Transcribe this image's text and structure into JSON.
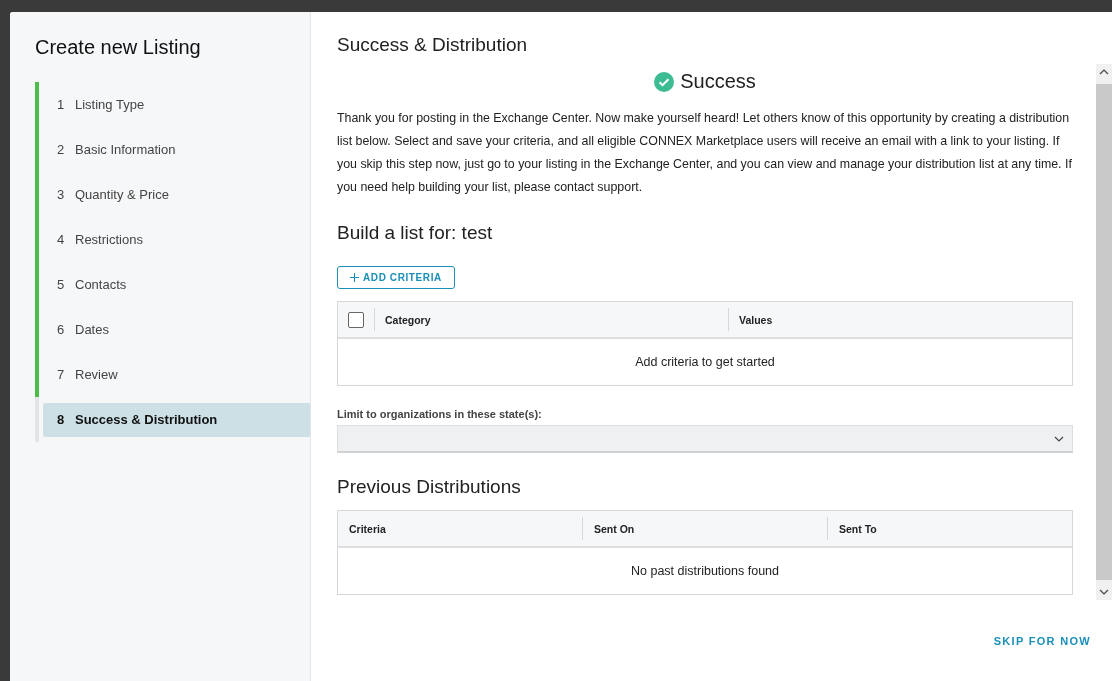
{
  "sidebar": {
    "title": "Create new Listing",
    "steps": [
      {
        "number": "1",
        "label": "Listing Type",
        "completed": true,
        "selected": false
      },
      {
        "number": "2",
        "label": "Basic Information",
        "completed": true,
        "selected": false
      },
      {
        "number": "3",
        "label": "Quantity & Price",
        "completed": true,
        "selected": false
      },
      {
        "number": "4",
        "label": "Restrictions",
        "completed": true,
        "selected": false
      },
      {
        "number": "5",
        "label": "Contacts",
        "completed": true,
        "selected": false
      },
      {
        "number": "6",
        "label": "Dates",
        "completed": true,
        "selected": false
      },
      {
        "number": "7",
        "label": "Review",
        "completed": true,
        "selected": false
      },
      {
        "number": "8",
        "label": "Success & Distribution",
        "completed": false,
        "selected": true
      }
    ]
  },
  "main": {
    "title": "Success & Distribution",
    "status": "Success",
    "message": "Thank you for posting in the Exchange Center. Now make yourself heard! Let others know of this opportunity by creating a distribution list below. Select and save your criteria, and all eligible CONNEX Marketplace users will receive an email with a link to your listing. If you skip this step now, just go to your listing in the Exchange Center, and you can view and manage your distribution list at any time. If you need help building your list, please contact support.",
    "build_title": "Build a list for: test",
    "add_button": "ADD CRITERIA",
    "criteria_table": {
      "select_all_checked": false,
      "columns": [
        "Category",
        "Values"
      ],
      "empty_text": "Add criteria to get started"
    },
    "state_filter": {
      "label": "Limit to organizations in these state(s):"
    },
    "previous_title": "Previous Distributions",
    "previous_table": {
      "columns": [
        "Criteria",
        "Sent On",
        "Sent To"
      ],
      "empty_text": "No past distributions found"
    }
  },
  "footer": {
    "skip_button": "SKIP FOR NOW"
  }
}
